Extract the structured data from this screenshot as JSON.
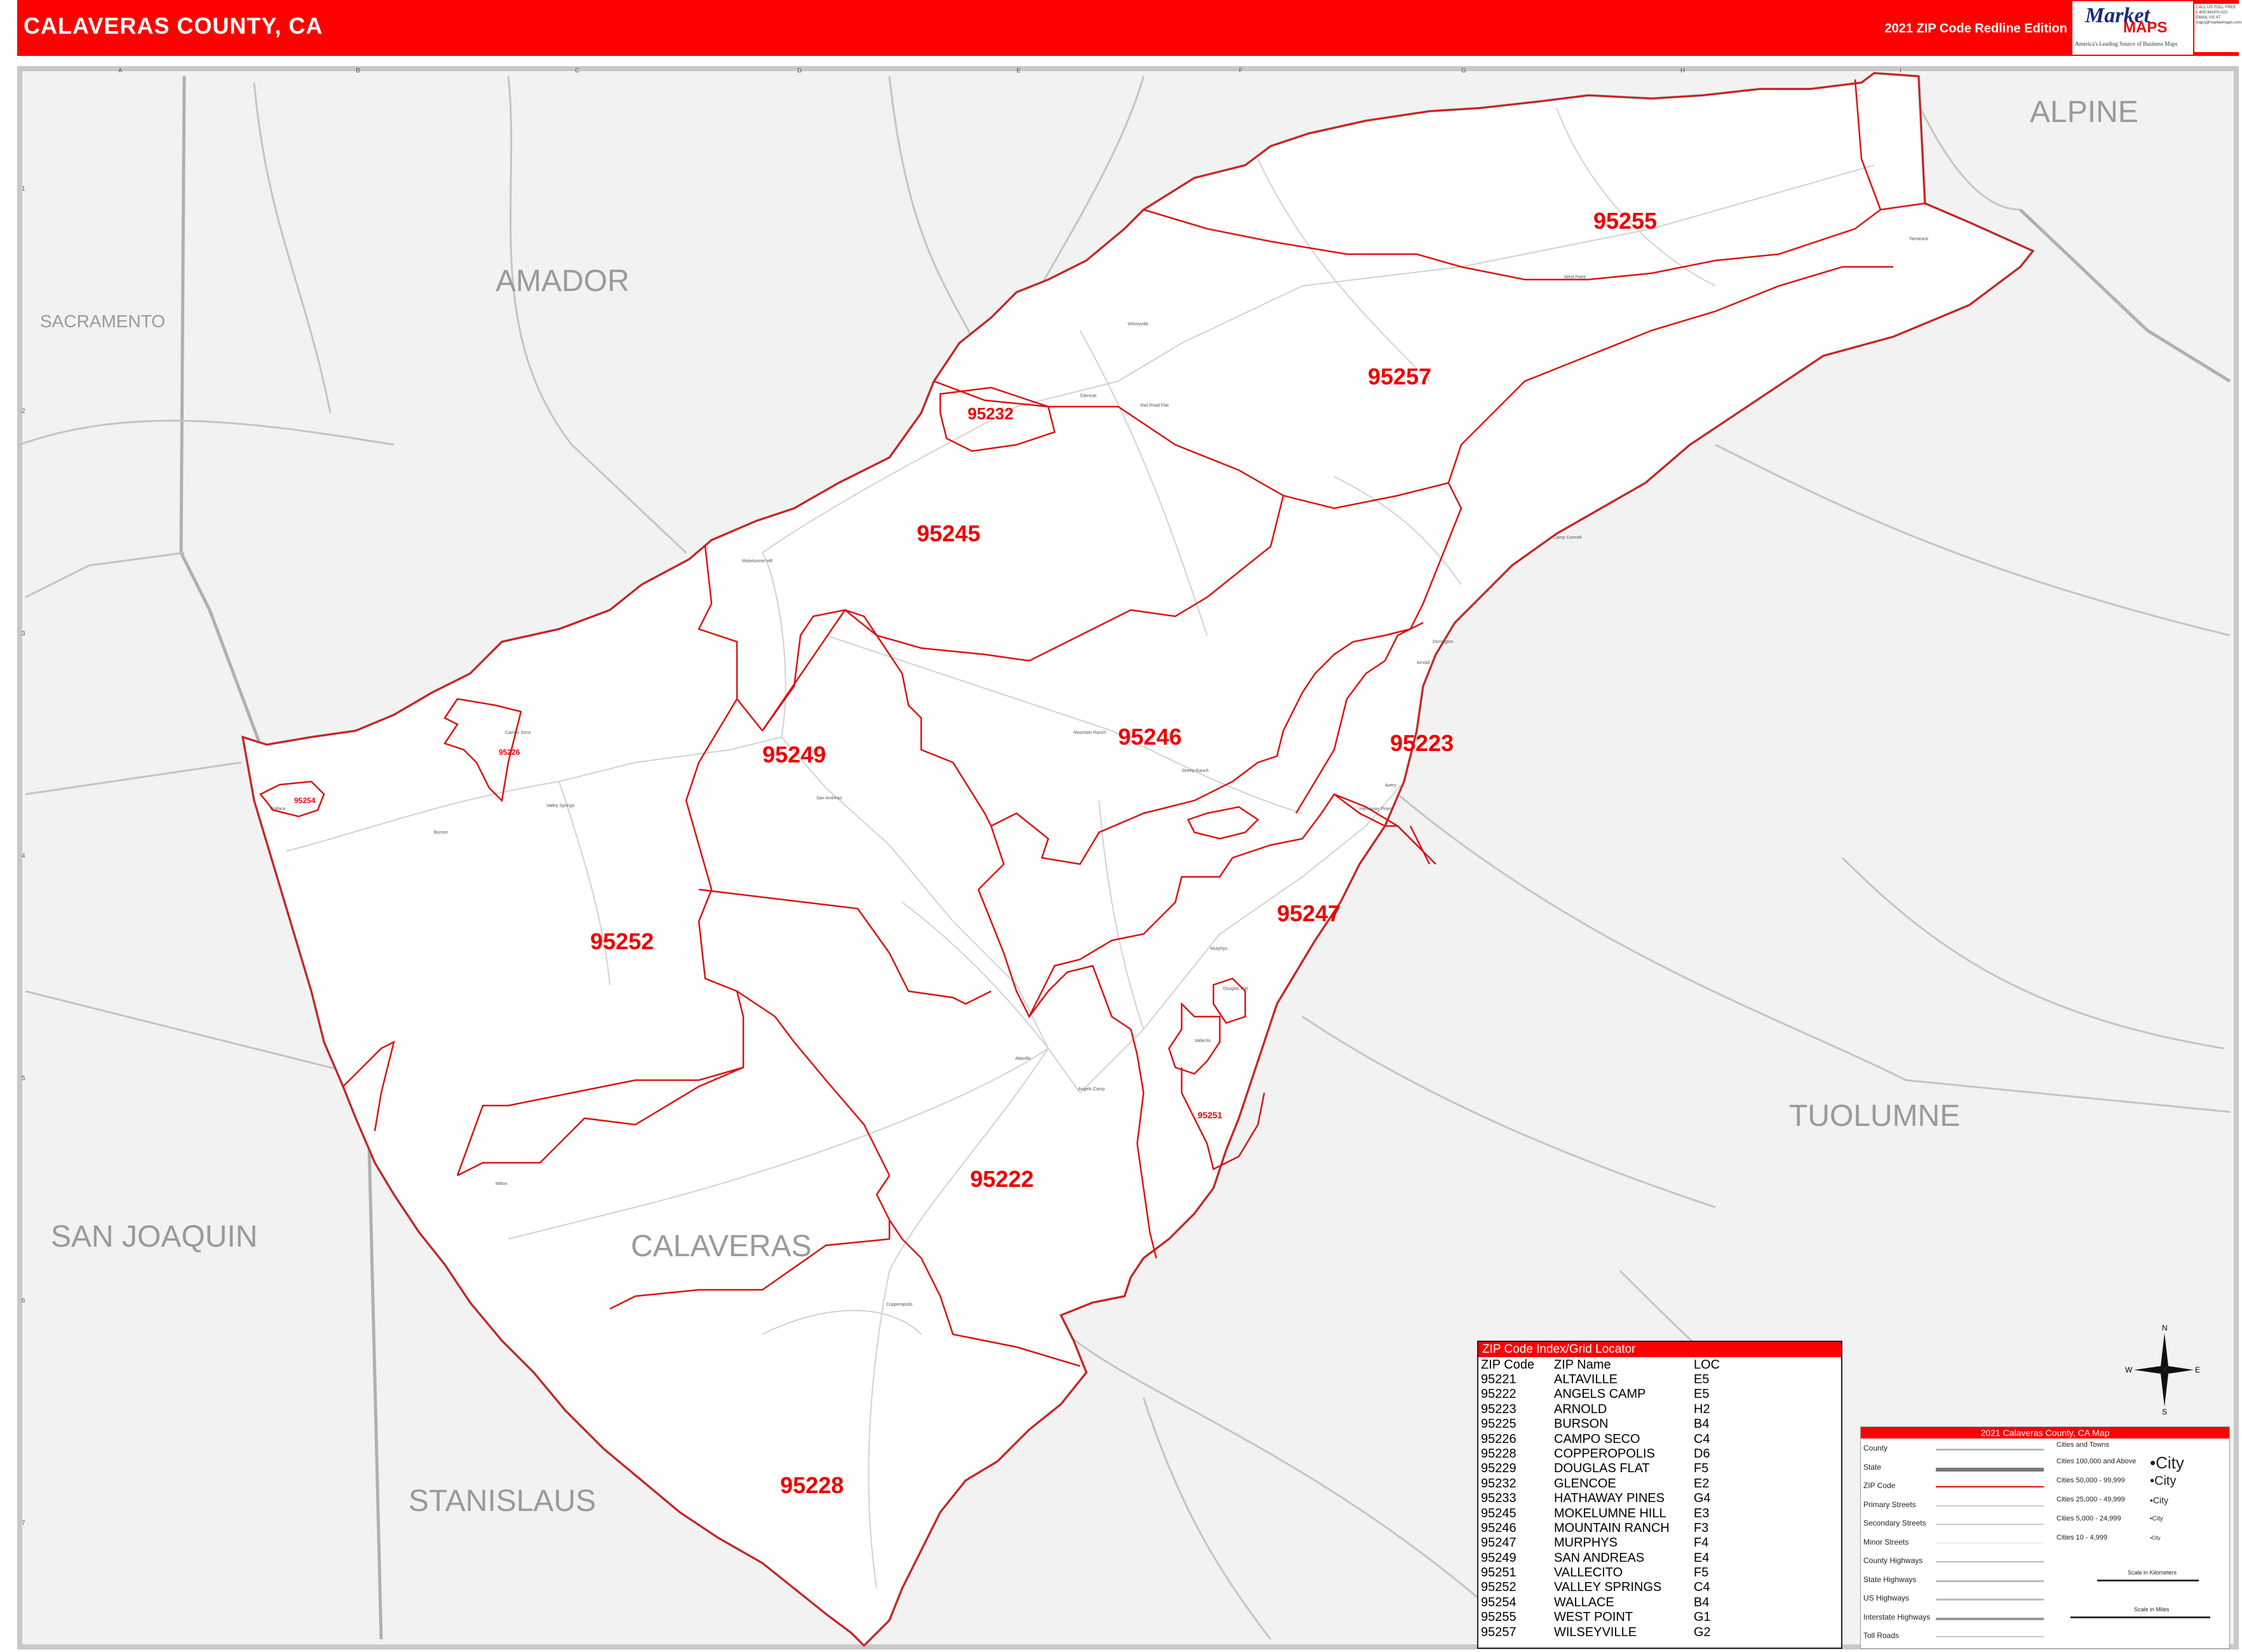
{
  "header": {
    "title": "CALAVERAS COUNTY, CA",
    "edition": "2021 ZIP Code Redline Edition",
    "logo_market": "Market",
    "logo_maps": "MAPS",
    "logo_tagline": "America's Leading Source of Business Maps",
    "contact_lines": [
      "CALL US TOLL FREE",
      "1-800-MAPS-022",
      "EMAIL US AT",
      "maps@marketmaps.com"
    ]
  },
  "colors": {
    "header_red": "#ff0000",
    "zip_boundary": "#dd1111",
    "county_fill": "#ffffff",
    "outside_fill": "#f2f2f2",
    "road_gray": "#bdbdbd",
    "county_label": "#9a9a9a"
  },
  "map": {
    "grid_columns": [
      "A",
      "B",
      "C",
      "D",
      "E",
      "F",
      "G",
      "H",
      "I"
    ],
    "grid_rows": [
      "1",
      "2",
      "3",
      "4",
      "5",
      "6",
      "7"
    ],
    "county_labels": [
      "SACRAMENTO",
      "AMADOR",
      "ALPINE",
      "SAN JOAQUIN",
      "CALAVERAS",
      "TUOLUMNE",
      "STANISLAUS"
    ],
    "zip_labels": [
      "95255",
      "95257",
      "95232",
      "95245",
      "95249",
      "95254",
      "95226",
      "95246",
      "95223",
      "95252",
      "95247",
      "95251",
      "95222",
      "95228"
    ],
    "place_names": [
      "West Point",
      "Wilseyville",
      "Glencoe",
      "Mokelumne Hill",
      "Mountain Ranch",
      "Sheep Ranch",
      "Arnold",
      "Avery",
      "Dorrington",
      "Hathaway Pines",
      "Murphys",
      "Vallecito",
      "Douglas Flat",
      "Altaville",
      "Angels Camp",
      "San Andreas",
      "Valley Springs",
      "Burson",
      "Wallace",
      "Campo Seco",
      "Copperopolis",
      "Milton",
      "Rail Road Flat",
      "Tamarack",
      "Camp Connell"
    ]
  },
  "zip_index": {
    "title": "ZIP Code Index/Grid Locator",
    "headers": [
      "ZIP Code",
      "ZIP Name",
      "LOC"
    ],
    "rows": [
      [
        "95221",
        "ALTAVILLE",
        "E5"
      ],
      [
        "95222",
        "ANGELS CAMP",
        "E5"
      ],
      [
        "95223",
        "ARNOLD",
        "H2"
      ],
      [
        "95225",
        "BURSON",
        "B4"
      ],
      [
        "95226",
        "CAMPO SECO",
        "C4"
      ],
      [
        "95228",
        "COPPEROPOLIS",
        "D6"
      ],
      [
        "95229",
        "DOUGLAS FLAT",
        "F5"
      ],
      [
        "95232",
        "GLENCOE",
        "E2"
      ],
      [
        "95233",
        "HATHAWAY PINES",
        "G4"
      ],
      [
        "95245",
        "MOKELUMNE HILL",
        "E3"
      ],
      [
        "95246",
        "MOUNTAIN RANCH",
        "F3"
      ],
      [
        "95247",
        "MURPHYS",
        "F4"
      ],
      [
        "95249",
        "SAN ANDREAS",
        "E4"
      ],
      [
        "95251",
        "VALLECITO",
        "F5"
      ],
      [
        "95252",
        "VALLEY SPRINGS",
        "C4"
      ],
      [
        "95254",
        "WALLACE",
        "B4"
      ],
      [
        "95255",
        "WEST POINT",
        "G1"
      ],
      [
        "95257",
        "WILSEYVILLE",
        "G2"
      ]
    ]
  },
  "legend": {
    "title": "2021 Calaveras County, CA Map",
    "items": [
      "County",
      "State",
      "ZIP Code",
      "Primary Streets",
      "Secondary Streets",
      "Minor Streets",
      "County Highways",
      "State Highways",
      "US Highways",
      "Interstate Highways",
      "Toll Roads"
    ],
    "cities_header": "Cities and Towns",
    "city_sizes": [
      "Cities 100,000 and Above",
      "Cities 50,000 - 99,999",
      "Cities 25,000 - 49,999",
      "Cities 5,000 - 24,999",
      "Cities 10 - 4,999"
    ],
    "city_samples": [
      "•City",
      "•City",
      "•City",
      "•City",
      "•City"
    ],
    "scale_km": "Scale in Kilometers",
    "scale_mi": "Scale in Miles"
  },
  "compass": {
    "n": "N",
    "s": "S",
    "e": "E",
    "w": "W"
  }
}
